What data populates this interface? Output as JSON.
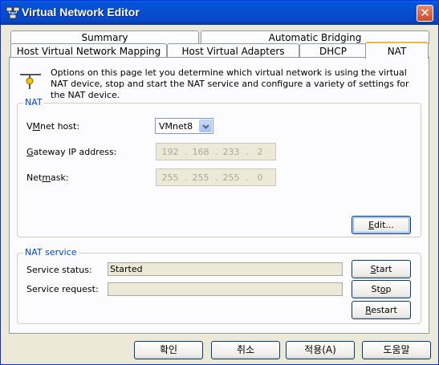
{
  "window": {
    "title": "Virtual Network Editor",
    "close_glyph": "✕"
  },
  "tabs": {
    "row1": [
      "Summary",
      "Automatic Bridging"
    ],
    "row2": [
      "Host Virtual Network Mapping",
      "Host Virtual Adapters",
      "DHCP",
      "NAT"
    ],
    "active": "NAT"
  },
  "info": {
    "icon": "network-icon",
    "text": "Options on this page let you determine which virtual network is using the virtual NAT device, stop and start the NAT service and configure a variety of settings for the NAT device."
  },
  "nat_group": {
    "title": "NAT",
    "vmnet_host_label_pre": "V",
    "vmnet_host_label_u": "M",
    "vmnet_host_label_post": "net host:",
    "vmnet_host_value": "VMnet8",
    "gateway_label_pre": "",
    "gateway_label_u": "G",
    "gateway_label_post": "ateway IP address:",
    "gateway_ip": [
      "192",
      "168",
      "233",
      "2"
    ],
    "netmask_label_pre": "Net",
    "netmask_label_u": "m",
    "netmask_label_post": "ask:",
    "netmask": [
      "255",
      "255",
      "255",
      "0"
    ],
    "edit_button_u": "E",
    "edit_button_post": "dit..."
  },
  "nat_service": {
    "title": "NAT service",
    "status_label": "Service status:",
    "status_value": "Started",
    "request_label": "Service request:",
    "request_value": "",
    "start_u": "S",
    "start_post": "tart",
    "stop_pre": "St",
    "stop_u": "o",
    "stop_post": "p",
    "restart_u": "R",
    "restart_post": "estart"
  },
  "footer": {
    "ok": "확인",
    "cancel": "취소",
    "apply": "적용(A)",
    "help": "도움말"
  }
}
